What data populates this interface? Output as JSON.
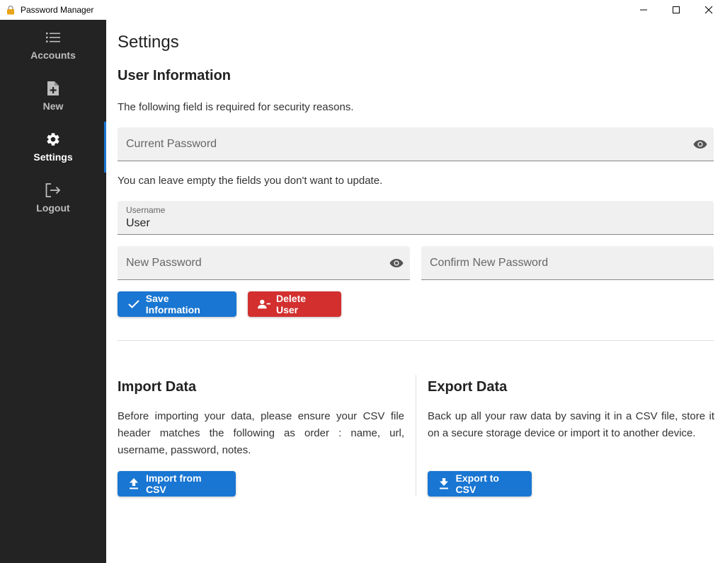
{
  "window": {
    "title": "Password Manager",
    "controls": [
      "minimize",
      "maximize",
      "close"
    ]
  },
  "sidebar": {
    "items": [
      {
        "label": "Accounts",
        "icon": "list-icon",
        "active": false
      },
      {
        "label": "New",
        "icon": "file-plus-icon",
        "active": false
      },
      {
        "label": "Settings",
        "icon": "gear-icon",
        "active": true
      },
      {
        "label": "Logout",
        "icon": "logout-icon",
        "active": false
      }
    ]
  },
  "main": {
    "title": "Settings",
    "user_info": {
      "heading": "User Information",
      "required_hint": "The following field is required for security reasons.",
      "current_password_placeholder": "Current Password",
      "update_hint": "You can leave empty the fields you don't want to update.",
      "username_label": "Username",
      "username_value": "User",
      "new_password_placeholder": "New Password",
      "confirm_password_placeholder": "Confirm New Password",
      "save_label": "Save Information",
      "delete_label": "Delete User"
    },
    "import": {
      "heading": "Import Data",
      "text": "Before importing your data, please ensure your CSV file header matches the following as order : name, url, username, password, notes.",
      "button_label": "Import from CSV"
    },
    "export": {
      "heading": "Export Data",
      "text": "Back up all your raw data by saving it in a CSV file, store it on a secure storage device or import it to another device.",
      "button_label": "Export to CSV"
    }
  },
  "colors": {
    "primary": "#1976d2",
    "danger": "#d32f2f",
    "sidebar_bg": "#232323",
    "field_bg": "#f0f0f0"
  }
}
